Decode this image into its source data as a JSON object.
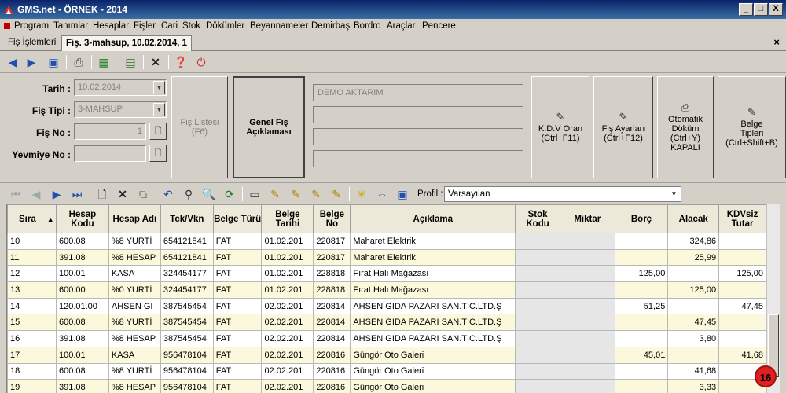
{
  "window": {
    "title": "GMS.net - ÖRNEK - 2014",
    "min": "_",
    "max": "□",
    "close": "X"
  },
  "menu": [
    "Program",
    "Tanımlar",
    "Hesaplar",
    "Fişler",
    "Cari",
    "Stok",
    "Dökümler",
    "Beyannameler",
    "Demirbaş",
    "Bordro",
    "Araçlar",
    "Pencere"
  ],
  "tabs": [
    {
      "label": "Fiş İşlemleri"
    },
    {
      "label": "Fiş. 3-mahsup, 10.02.2014, 1"
    }
  ],
  "tab_close": "×",
  "form": {
    "tarih_label": "Tarih :",
    "tarih_value": "10.02.2014",
    "fis_tipi_label": "Fiş Tipi :",
    "fis_tipi_value": "3-MAHSUP",
    "fis_no_label": "Fiş No :",
    "fis_no_value": "1",
    "yevmiye_label": "Yevmiye No :",
    "yevmiye_value": ""
  },
  "buttons": {
    "fis_listesi": "Fiş Listesi",
    "fis_listesi_key": "(F6)",
    "genel_fis": "Genel Fiş",
    "genel_fis2": "Açıklaması",
    "kdv_oran": "K.D.V Oran",
    "kdv_oran_key": "(Ctrl+F11)",
    "fis_ayarlari": "Fiş Ayarları",
    "fis_ayarlari_key": "(Ctrl+F12)",
    "otomatik1": "Otomatik",
    "otomatik2": "Döküm",
    "otomatik3": "(Ctrl+Y)",
    "otomatik4": "KAPALI",
    "belge1": "Belge",
    "belge2": "Tipleri",
    "belge3": "(Ctrl+Shift+B)"
  },
  "description": {
    "line1": "DEMO AKTARIM",
    "line2": "",
    "line3": "",
    "line4": ""
  },
  "profil": {
    "label": "Profil :",
    "value": "Varsayılan"
  },
  "columns": [
    "Sıra",
    "Hesap Kodu",
    "Hesap Adı",
    "Tck/Vkn",
    "Belge Türü",
    "Belge Tarihi",
    "Belge No",
    "Açıklama",
    "Stok Kodu",
    "Miktar",
    "Borç",
    "Alacak",
    "KDVsiz Tutar"
  ],
  "sort_indicator": "▲",
  "rows": [
    [
      "10",
      "600.08",
      "%8 YURTİ",
      "654121841",
      "FAT",
      "01.02.201",
      "220817",
      "Maharet Elektrik",
      "",
      "",
      "",
      "324,86",
      ""
    ],
    [
      "11",
      "391.08",
      "%8 HESAP",
      "654121841",
      "FAT",
      "01.02.201",
      "220817",
      "Maharet Elektrik",
      "",
      "",
      "",
      "25,99",
      ""
    ],
    [
      "12",
      "100.01",
      "KASA",
      "324454177",
      "FAT",
      "01.02.201",
      "228818",
      "Fırat Halı Mağazası",
      "",
      "",
      "125,00",
      "",
      "125,00"
    ],
    [
      "13",
      "600.00",
      "%0 YURTİ",
      "324454177",
      "FAT",
      "01.02.201",
      "228818",
      "Fırat Halı Mağazası",
      "",
      "",
      "",
      "125,00",
      ""
    ],
    [
      "14",
      "120.01.00",
      "AHSEN GI",
      "387545454",
      "FAT",
      "02.02.201",
      "220814",
      "AHSEN GIDA PAZARI SAN.TİC.LTD.Ş",
      "",
      "",
      "51,25",
      "",
      "47,45"
    ],
    [
      "15",
      "600.08",
      "%8 YURTİ",
      "387545454",
      "FAT",
      "02.02.201",
      "220814",
      "AHSEN GIDA PAZARI SAN.TİC.LTD.Ş",
      "",
      "",
      "",
      "47,45",
      ""
    ],
    [
      "16",
      "391.08",
      "%8 HESAP",
      "387545454",
      "FAT",
      "02.02.201",
      "220814",
      "AHSEN GIDA PAZARI SAN.TİC.LTD.Ş",
      "",
      "",
      "",
      "3,80",
      ""
    ],
    [
      "17",
      "100.01",
      "KASA",
      "956478104",
      "FAT",
      "02.02.201",
      "220816",
      "Güngör Oto Galeri",
      "",
      "",
      "45,01",
      "",
      "41,68"
    ],
    [
      "18",
      "600.08",
      "%8 YURTİ",
      "956478104",
      "FAT",
      "02.02.201",
      "220816",
      "Güngör Oto Galeri",
      "",
      "",
      "",
      "41,68",
      ""
    ],
    [
      "19",
      "391.08",
      "%8 HESAP",
      "956478104",
      "FAT",
      "02.02.201",
      "220816",
      "Güngör Oto Galeri",
      "",
      "",
      "",
      "3,33",
      ""
    ]
  ],
  "badge": "16"
}
